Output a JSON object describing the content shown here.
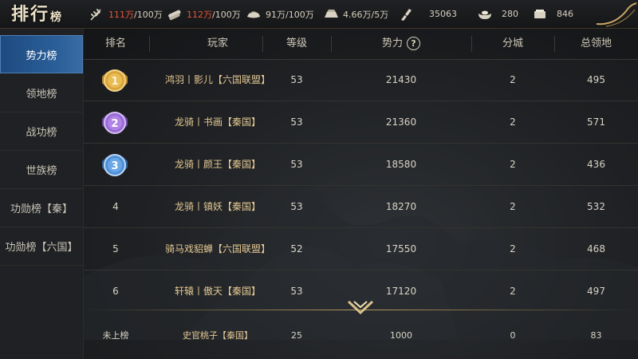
{
  "title": {
    "main": "排行",
    "sub": "榜"
  },
  "resources": [
    {
      "icon": "grain-icon",
      "current": "111万",
      "max": "/100万",
      "over": true
    },
    {
      "icon": "wood-icon",
      "current": "112万",
      "max": "/100万",
      "over": true
    },
    {
      "icon": "stone-icon",
      "current": "91万",
      "max": "/100万",
      "over": false
    },
    {
      "icon": "iron-icon",
      "current": "4.66万",
      "max": "/5万",
      "over": false
    },
    {
      "icon": "token-icon",
      "current": "35063",
      "max": "",
      "over": false
    },
    {
      "icon": "gold-ingot-icon",
      "current": "280",
      "max": "",
      "over": false
    },
    {
      "icon": "silver-ingot-icon",
      "current": "846",
      "max": "",
      "over": false
    }
  ],
  "sidebar": {
    "items": [
      {
        "label": "势力榜",
        "active": true
      },
      {
        "label": "领地榜",
        "active": false
      },
      {
        "label": "战功榜",
        "active": false
      },
      {
        "label": "世族榜",
        "active": false
      },
      {
        "label": "功勋榜【秦】",
        "active": false
      },
      {
        "label": "功勋榜【六国】",
        "active": false
      }
    ]
  },
  "table": {
    "headers": [
      "排名",
      "玩家",
      "等级",
      "势力",
      "分城",
      "总领地"
    ],
    "rows": [
      {
        "rank": "1",
        "player": "鸿羽丨影儿【六国联盟】",
        "level": "53",
        "power": "21430",
        "branch": "2",
        "territory": "495"
      },
      {
        "rank": "2",
        "player": "龙骑丨书画【秦国】",
        "level": "53",
        "power": "21360",
        "branch": "2",
        "territory": "571"
      },
      {
        "rank": "3",
        "player": "龙骑丨颜王【秦国】",
        "level": "53",
        "power": "18580",
        "branch": "2",
        "territory": "436"
      },
      {
        "rank": "4",
        "player": "龙骑丨镇妖【秦国】",
        "level": "53",
        "power": "18270",
        "branch": "2",
        "territory": "532"
      },
      {
        "rank": "5",
        "player": "骑马戏貂蝉【六国联盟】",
        "level": "52",
        "power": "17550",
        "branch": "2",
        "territory": "468"
      },
      {
        "rank": "6",
        "player": "轩辕丨傲天【秦国】",
        "level": "53",
        "power": "17120",
        "branch": "2",
        "territory": "497"
      }
    ],
    "self": {
      "rank": "未上榜",
      "player": "史官桃子【秦国】",
      "level": "25",
      "power": "1000",
      "branch": "0",
      "territory": "83"
    }
  },
  "colors": {
    "accent_blue": "#2b5f99",
    "gold_text": "#e3c893",
    "over_cap_red": "#e6553d",
    "medal_gold": "#d9a53a",
    "medal_purple": "#9b6ad6",
    "medal_blue": "#4e8fd8"
  }
}
